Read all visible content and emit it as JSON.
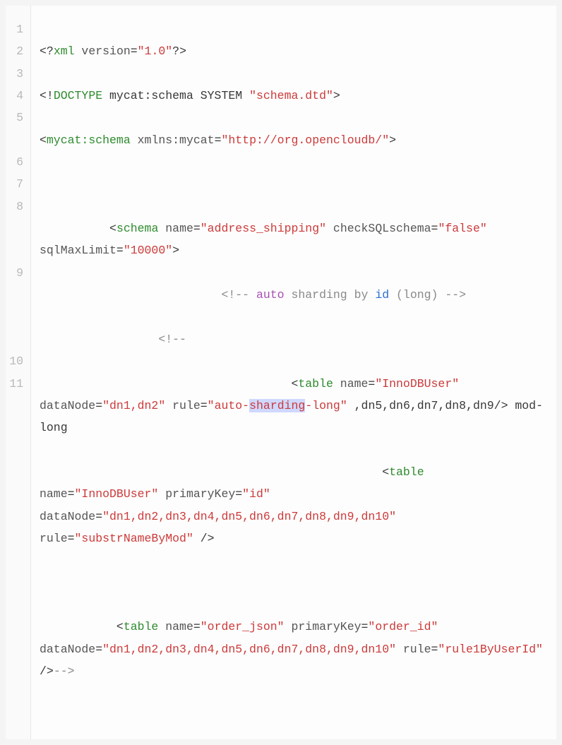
{
  "gutter": {
    "1": "1",
    "2": "2",
    "3": "3",
    "4": "4",
    "5": "5",
    "6": "6",
    "7": "7",
    "8": "8",
    "9": "9",
    "10": "10",
    "11": "11"
  },
  "l1": {
    "a": "<?",
    "b": "xml",
    "c": " version",
    "d": "=",
    "e": "\"1.0\"",
    "f": "?>"
  },
  "l2": {
    "a": "<!",
    "b": "DOCTYPE",
    "c": " mycat:schema SYSTEM ",
    "d": "\"schema.dtd\"",
    "e": ">"
  },
  "l3": {
    "a": "<",
    "b": "mycat:schema",
    "c": " xmlns:mycat",
    "d": "=",
    "e": "\"http://org.opencloudb/\"",
    "f": ">"
  },
  "l4": {
    "a": ""
  },
  "l5": {
    "pad": "          ",
    "a": "<",
    "b": "schema",
    "c": " name",
    "d": "=",
    "e": "\"address_shipping\"",
    "f": " checkSQLschema",
    "g": "=",
    "h": "\"false\"",
    "i": " sqlMaxLimit",
    "j": "=",
    "k": "\"10000\"",
    "l": ">"
  },
  "l6": {
    "pad": "                          ",
    "a": "<!-- ",
    "b": "auto",
    "c": " sharding by ",
    "d": "id",
    "e": " (long) ",
    "f": "-->"
  },
  "l7": {
    "pad": "                 ",
    "a": "<!--"
  },
  "l8": {
    "pad": "                                    ",
    "a": "<",
    "b": "table",
    "c": " name",
    "d": "=",
    "e": "\"InnoDBUser\"",
    "f": " dataNode",
    "g": "=",
    "h": "\"dn1,dn2\"",
    "i": " rule",
    "j": "=",
    "k": "\"auto-",
    "hl": "sharding",
    "k2": "-long\"",
    "l": " ,dn5,dn6,dn7,dn8,dn9/> mod-long"
  },
  "l9": {
    "pad": "                                                 ",
    "a": "<",
    "b": "table",
    "c": " name",
    "d": "=",
    "e": "\"InnoDBUser\"",
    "f": " primaryKey",
    "g": "=",
    "h": "\"id\"",
    "i": " dataNode",
    "j": "=",
    "k": "\"dn1,dn2,dn3,dn4,dn5,dn6,dn7,dn8,dn9,dn10\"",
    "l": " rule",
    "m": "=",
    "n": "\"substrNameByMod\"",
    "o": " />"
  },
  "l10": {
    "a": ""
  },
  "l11": {
    "pad": "           ",
    "a": "<",
    "b": "table",
    "c": " name",
    "d": "=",
    "e": "\"order_json\"",
    "f": " primaryKey",
    "g": "=",
    "h": "\"order_id\"",
    "i": " dataNode",
    "j": "=",
    "k": "\"dn1,dn2,dn3,dn4,dn5,dn6,dn7,dn8,dn9,dn10\"",
    "l": " rule",
    "m": "=",
    "n": "\"rule1ByUserId\"",
    "o": " />",
    "p": "-->"
  }
}
